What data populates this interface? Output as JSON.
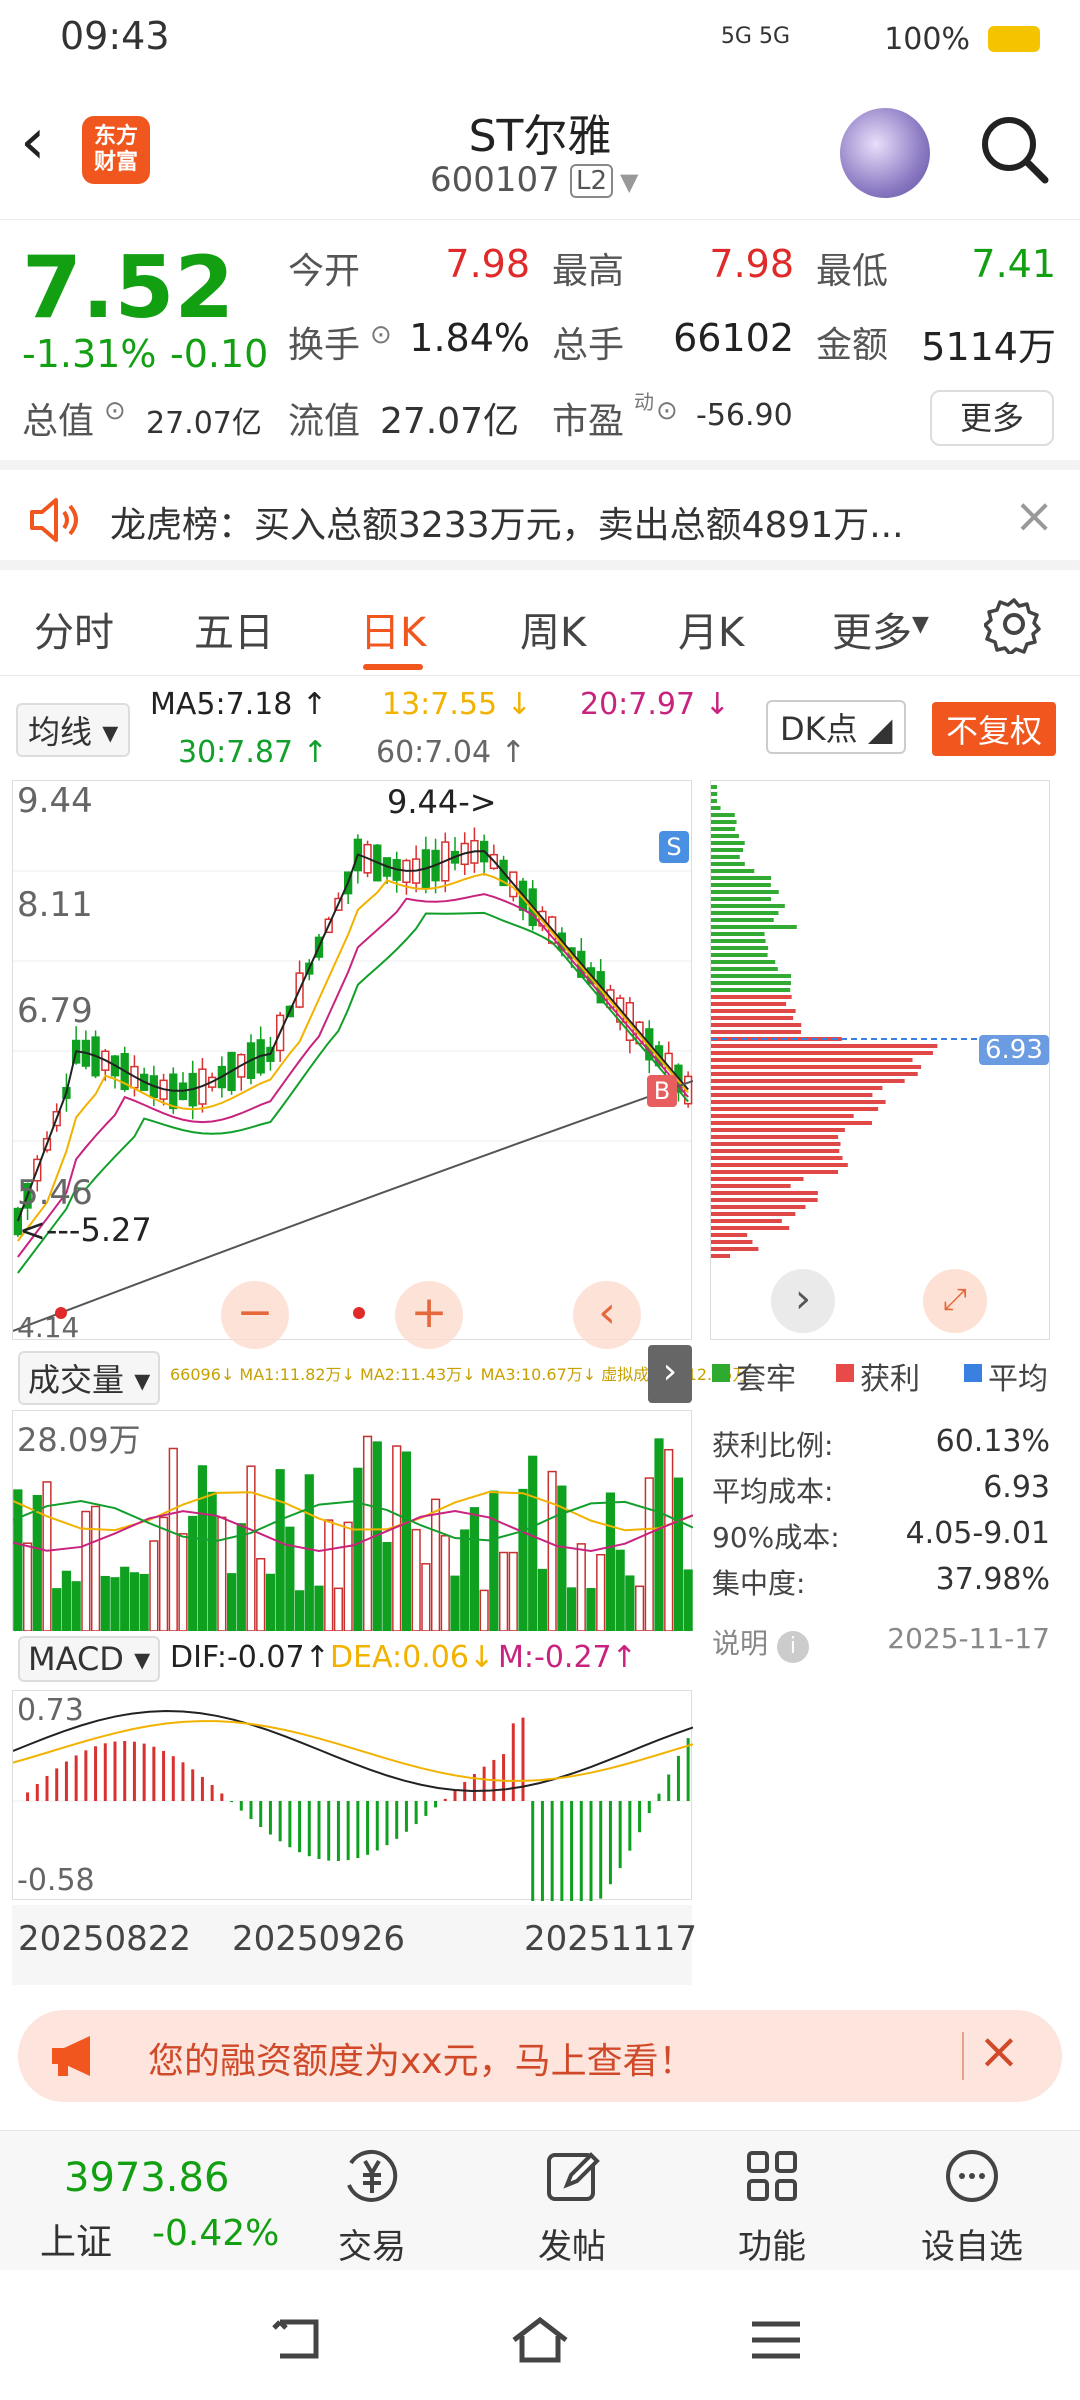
{
  "status": {
    "time": "09:43",
    "battery": "100%",
    "network": "5G 5G"
  },
  "header": {
    "back": "‹",
    "logo": "东方\n财富",
    "name": "ST尔雅",
    "code": "600107",
    "level": "L2"
  },
  "quote": {
    "price": "7.52",
    "change_pct": "-1.31%",
    "change": "-0.10",
    "open_label": "今开",
    "open": "7.98",
    "high_label": "最高",
    "high": "7.98",
    "low_label": "最低",
    "low": "7.41",
    "turnover_label": "换手",
    "turnover": "1.84%",
    "volume_label": "总手",
    "volume": "66102",
    "amount_label": "金额",
    "amount": "5114万",
    "mktcap_label": "总值",
    "mktcap": "27.07亿",
    "float_label": "流值",
    "float": "27.07亿",
    "pe_label": "市盈",
    "pe_sup": "动",
    "pe": "-56.90",
    "more": "更多"
  },
  "notice": {
    "text": "龙虎榜：买入总额3233万元，卖出总额4891万..."
  },
  "tabs": [
    "分时",
    "五日",
    "日K",
    "周K",
    "月K",
    "更多"
  ],
  "ma": {
    "selector": "均线",
    "ma5": "MA5:7.18 ↑",
    "ma13": "13:7.55 ↓",
    "ma20": "20:7.97 ↓",
    "ma30": "30:7.87 ↑",
    "ma60": "60:7.04 ↑",
    "dk": "DK点",
    "fuquan": "不复权"
  },
  "kchart": {
    "y_top": "9.44",
    "y_mid1": "8.11",
    "y_mid2": "6.79",
    "y_low": "5.46",
    "y_bottom": "4.14",
    "max_label": "9.44->",
    "min_label": "<---5.27",
    "s_mark": "S",
    "b_mark": "B",
    "avg_cost": "6.93"
  },
  "volume": {
    "selector": "成交量",
    "line": "66096↓ MA1:11.82万↓ MA2:11.43万↓ MA3:10.67万↓ 虚拟成交量:12.65万",
    "max": "28.09万"
  },
  "macd": {
    "selector": "MACD",
    "dif": "DIF:-0.07↑",
    "dea": "DEA:0.06↓",
    "m": "M:-0.27↑",
    "top": "0.73",
    "bottom": "-0.58"
  },
  "dates": [
    "20250822",
    "20250926",
    "20251117"
  ],
  "chip": {
    "legend": [
      "套牢",
      "获利",
      "平均"
    ],
    "rows": [
      {
        "label": "获利比例:",
        "value": "60.13%"
      },
      {
        "label": "平均成本:",
        "value": "6.93"
      },
      {
        "label": "90%成本:",
        "value": "4.05-9.01"
      },
      {
        "label": "集中度:",
        "value": "37.98%"
      }
    ],
    "note": "说明",
    "date": "2025-11-17"
  },
  "promo": {
    "text": "您的融资额度为xx元，马上查看！"
  },
  "bottom": {
    "index_value": "3973.86",
    "index_name": "上证",
    "index_change": "-0.42%",
    "items": [
      {
        "label": "交易"
      },
      {
        "label": "发帖"
      },
      {
        "label": "功能"
      },
      {
        "label": "设自选"
      }
    ]
  },
  "colors": {
    "up": "#e02a2a",
    "down": "#12a012",
    "accent": "#f0561e"
  }
}
